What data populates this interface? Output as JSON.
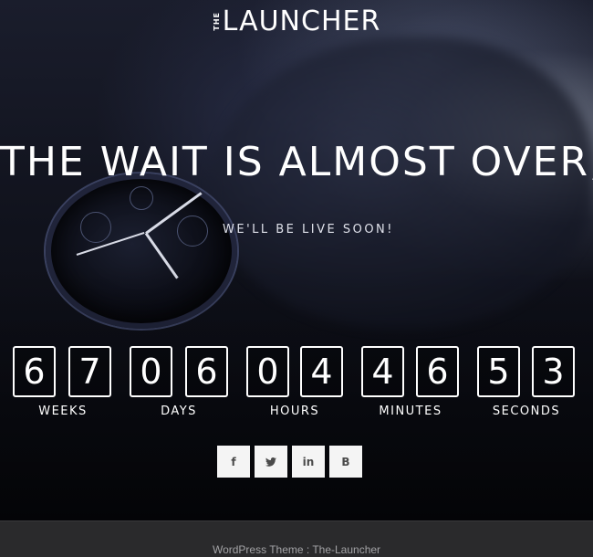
{
  "brand": {
    "prefix": "THE",
    "name": "LAUNCHER"
  },
  "hero": {
    "headline": "THE WAIT IS ALMOST OVER,",
    "subheadline": "WE'LL BE LIVE SOON!"
  },
  "countdown": [
    {
      "digits": [
        "6",
        "7"
      ],
      "label": "WEEKS"
    },
    {
      "digits": [
        "0",
        "6"
      ],
      "label": "DAYS"
    },
    {
      "digits": [
        "0",
        "4"
      ],
      "label": "HOURS"
    },
    {
      "digits": [
        "4",
        "6"
      ],
      "label": "MINUTES"
    },
    {
      "digits": [
        "5",
        "3"
      ],
      "label": "SECONDS"
    }
  ],
  "social": [
    {
      "icon": "facebook-icon",
      "glyph": "f"
    },
    {
      "icon": "twitter-icon",
      "glyph": "🐦"
    },
    {
      "icon": "linkedin-icon",
      "glyph": "in"
    },
    {
      "icon": "blogger-icon",
      "glyph": "B"
    }
  ],
  "footer": {
    "text": "WordPress Theme : The-Launcher"
  },
  "colors": {
    "background": "#0b0d14",
    "footer": "#2a2a2c",
    "text": "#ffffff",
    "social_bg": "#f4f4f4"
  }
}
